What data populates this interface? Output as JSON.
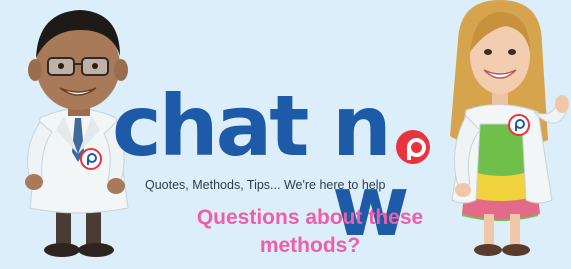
{
  "brand": {
    "logo_word_1": "chat",
    "logo_word_2": "n",
    "logo_word_3": "w"
  },
  "tagline": "Quotes, Methods, Tips... We're here to help",
  "question": "Questions about these methods?",
  "colors": {
    "background": "#dbeef9",
    "logo_blue": "#1d5aa8",
    "accent_red": "#e8343e",
    "question_pink": "#ef5ea8"
  },
  "icons": {
    "logo_o": "pin-circle-icon",
    "badge": "pin-badge-icon"
  }
}
